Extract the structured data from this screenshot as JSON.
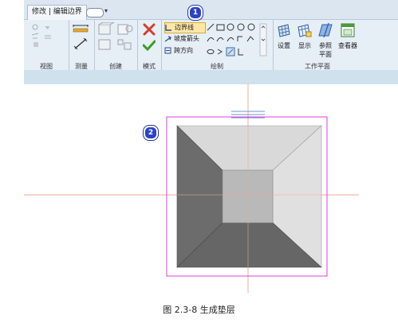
{
  "ribbon": {
    "active_tab": "修改 | 编辑边界",
    "panels": {
      "view": "视图",
      "measure": "测量",
      "create": "创建",
      "mode": "模式",
      "draw": "绘制",
      "workplane": "工作平面"
    },
    "draw_tools": {
      "boundary_line": "边界线",
      "slope_arrow": "坡度箭头",
      "span_direction": "跨方向"
    },
    "workplane_buttons": {
      "set": "设置",
      "show": "显示",
      "ref_plane_line1": "参照",
      "ref_plane_line2": "平面",
      "viewer": "查看器"
    }
  },
  "callouts": {
    "one": "1",
    "two": "2"
  },
  "caption": "图 2.3-8  生成垫层",
  "colors": {
    "selection": "#e23be0",
    "refline": "#f0a89a",
    "ribbon_bg": "#e6eef6",
    "callout": "#2a44c7"
  }
}
